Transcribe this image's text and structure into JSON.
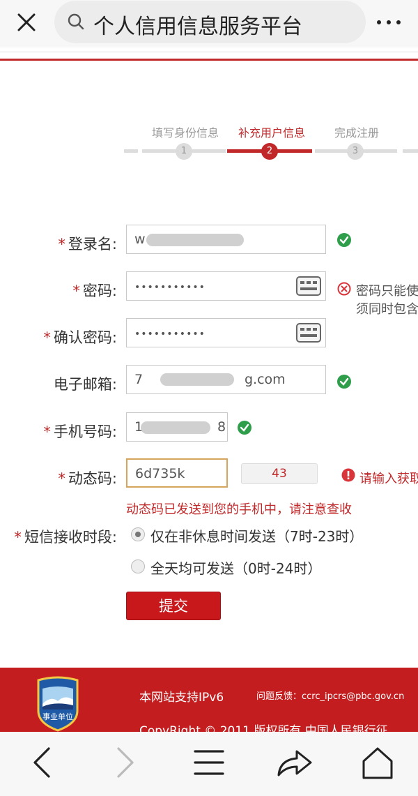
{
  "browser": {
    "title": "个人信用信息服务平台"
  },
  "steps": [
    {
      "label": "填写身份信息",
      "number": "1",
      "active": false
    },
    {
      "label": "补充用户信息",
      "number": "2",
      "active": true
    },
    {
      "label": "完成注册",
      "number": "3",
      "active": false
    }
  ],
  "form": {
    "login_name": {
      "label": "登录名:",
      "required": "*",
      "value": "w"
    },
    "password": {
      "label": "密码:",
      "required": "*",
      "value": "•••••••••••",
      "error_line1": "密码只能使",
      "error_line2": "须同时包含"
    },
    "confirm_password": {
      "label": "确认密码:",
      "required": "*",
      "value": "•••••••••••"
    },
    "email": {
      "label": "电子邮箱:",
      "value_suffix": "g.com",
      "value_prefix": "7"
    },
    "phone": {
      "label": "手机号码:",
      "required": "*",
      "value_prefix": "1",
      "value_suffix": "8"
    },
    "dynamic_code": {
      "label": "动态码:",
      "required": "*",
      "value": "6d735k",
      "timer": "43",
      "error": "请输入获取",
      "sent_notice": "动态码已发送到您的手机中，请注意查收"
    },
    "sms_period": {
      "label": "短信接收时段:",
      "required": "*",
      "options": [
        {
          "label": "仅在非休息时间发送（7时-23时）",
          "checked": true
        },
        {
          "label": "全天均可发送（0时-24时）",
          "checked": false
        }
      ]
    },
    "submit_label": "提交"
  },
  "footer": {
    "badge_text": "事业单位",
    "ipv6": "本网站支持IPv6",
    "feedback": "问题反馈：ccrc_ipcrs@pbc.gov.cn",
    "copyright": "CopyRight © 2011   版权所有   中国人民银行征"
  },
  "colors": {
    "brand_red": "#c0282a",
    "footer_red": "#c41d1f",
    "success_green": "#2e9e4a"
  }
}
